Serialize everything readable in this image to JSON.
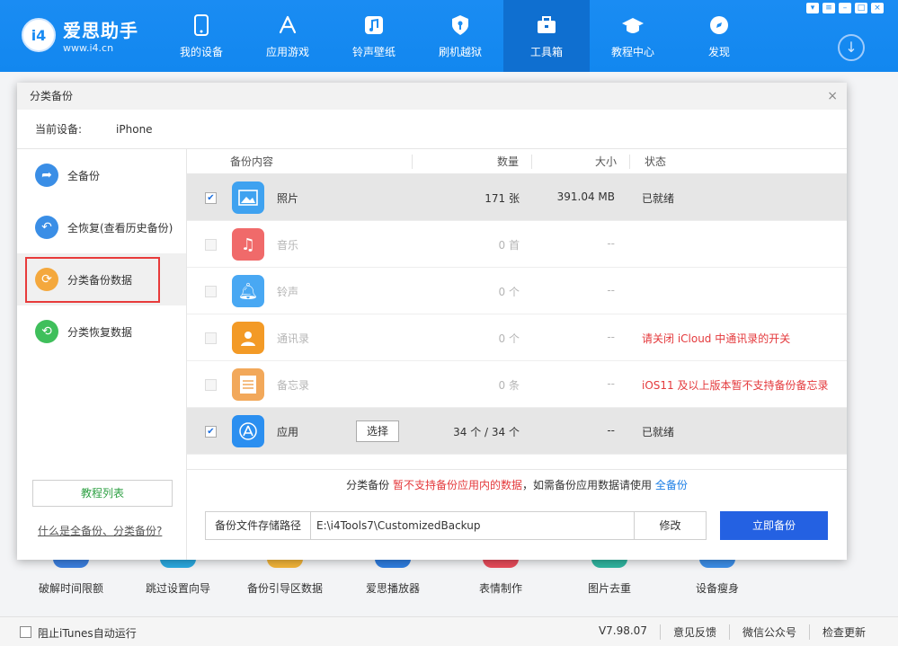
{
  "header": {
    "logo_badge": "i4",
    "logo_name": "爱思助手",
    "logo_url": "www.i4.cn",
    "nav": [
      {
        "label": "我的设备",
        "icon": "phone-icon"
      },
      {
        "label": "应用游戏",
        "icon": "app-store-icon"
      },
      {
        "label": "铃声壁纸",
        "icon": "music-note-icon"
      },
      {
        "label": "刷机越狱",
        "icon": "shield-key-icon"
      },
      {
        "label": "工具箱",
        "icon": "toolbox-icon"
      },
      {
        "label": "教程中心",
        "icon": "graduation-cap-icon"
      },
      {
        "label": "发现",
        "icon": "compass-icon"
      }
    ],
    "active_nav": "工具箱"
  },
  "dialog": {
    "title": "分类备份",
    "device_label": "当前设备:",
    "device_value": "iPhone",
    "sidebar": {
      "items": [
        {
          "label": "全备份",
          "icon": "forward-arrow-icon",
          "color": "#3a8ee6"
        },
        {
          "label": "全恢复(查看历史备份)",
          "icon": "back-arrow-icon",
          "color": "#3a8ee6"
        },
        {
          "label": "分类备份数据",
          "icon": "category-backup-icon",
          "color": "#f4a83d"
        },
        {
          "label": "分类恢复数据",
          "icon": "category-restore-icon",
          "color": "#3fbf5b"
        }
      ],
      "tutorial_button": "教程列表",
      "what_link": "什么是全备份、分类备份?"
    },
    "table": {
      "headers": {
        "content": "备份内容",
        "count": "数量",
        "size": "大小",
        "status": "状态"
      },
      "rows": [
        {
          "name": "照片",
          "count": "171 张",
          "size": "391.04 MB",
          "status": "已就绪",
          "checked": true,
          "enabled": true,
          "icon": "photos-icon",
          "color": "#3fa2f0"
        },
        {
          "name": "音乐",
          "count": "0 首",
          "size": "--",
          "status": "",
          "checked": false,
          "enabled": false,
          "icon": "music-icon",
          "color": "#f06a6a"
        },
        {
          "name": "铃声",
          "count": "0 个",
          "size": "--",
          "status": "",
          "checked": false,
          "enabled": false,
          "icon": "bell-icon",
          "color": "#49a8f3"
        },
        {
          "name": "通讯录",
          "count": "0 个",
          "size": "--",
          "status": "请关闭 iCloud 中通讯录的开关",
          "checked": false,
          "enabled": false,
          "icon": "contacts-icon",
          "color": "#f39a26"
        },
        {
          "name": "备忘录",
          "count": "0 条",
          "size": "--",
          "status": "iOS11 及以上版本暂不支持备份备忘录",
          "checked": false,
          "enabled": false,
          "icon": "notes-icon",
          "color": "#f2a85a"
        },
        {
          "name": "应用",
          "count": "34 个 / 34 个",
          "size": "--",
          "status": "已就绪",
          "checked": true,
          "enabled": true,
          "icon": "app-store-icon",
          "color": "#2b8ff0",
          "select_label": "选择"
        }
      ]
    },
    "notice": {
      "part1": "分类备份 ",
      "part2": "暂不支持备份应用内的数据",
      "part3": "，如需备份应用数据请使用 ",
      "link": "全备份"
    },
    "path_label": "备份文件存储路径",
    "path_value": "E:\\i4Tools7\\CustomizedBackup",
    "change_button": "修改",
    "backup_button": "立即备份"
  },
  "background_tools": [
    "破解时间限额",
    "跳过设置向导",
    "备份引导区数据",
    "爱思播放器",
    "表情制作",
    "图片去重",
    "设备瘦身"
  ],
  "bottom_bar": {
    "itunes_label": "阻止iTunes自动运行",
    "version": "V7.98.07",
    "feedback": "意见反馈",
    "wechat": "微信公众号",
    "update": "检查更新"
  }
}
